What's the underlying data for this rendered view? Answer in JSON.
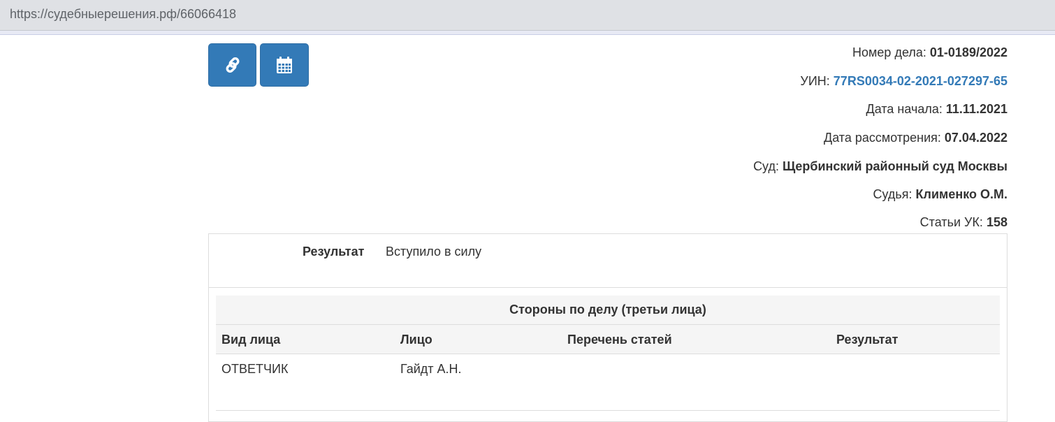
{
  "browser": {
    "url": "https://судебныерешения.рф/66066418"
  },
  "toolbar": {
    "link_icon": "link-icon",
    "calendar_icon": "calendar-icon"
  },
  "case_meta": {
    "case_number_label": "Номер дела:",
    "case_number": "01-0189/2022",
    "uin_label": "УИН:",
    "uin": "77RS0034-02-2021-027297-65",
    "start_date_label": "Дата начала:",
    "start_date": "11.11.2021",
    "review_date_label": "Дата рассмотрения:",
    "review_date": "07.04.2022",
    "court_label": "Суд:",
    "court": "Щербинский районный суд Москвы",
    "judge_label": "Судья:",
    "judge": "Клименко О.М.",
    "articles_label": "Статьи УК:",
    "articles": "158"
  },
  "result": {
    "label": "Результат",
    "value": "Вступило в силу"
  },
  "parties_table": {
    "caption": "Стороны по делу (третьи лица)",
    "headers": [
      "Вид лица",
      "Лицо",
      "Перечень статей",
      "Результат"
    ],
    "rows": [
      [
        "ОТВЕТЧИК",
        "Гайдт А.Н.",
        "",
        ""
      ]
    ]
  },
  "colors": {
    "primary": "#337ab7",
    "link": "#337ab7",
    "table_head_bg": "#f5f5f5"
  }
}
